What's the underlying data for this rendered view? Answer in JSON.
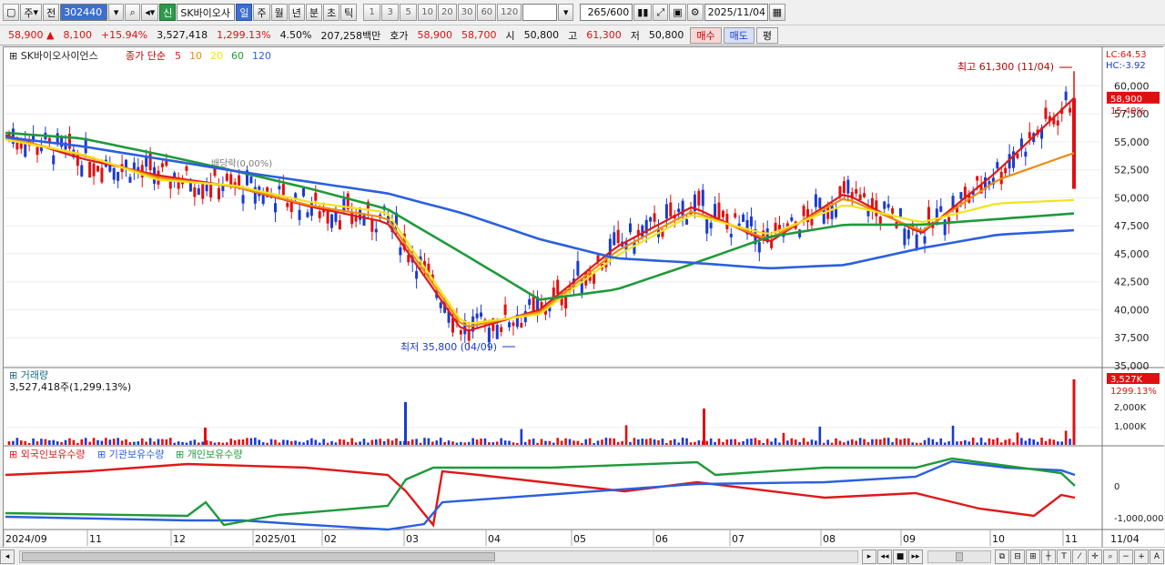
{
  "toolbar": {
    "mode": "주",
    "prev": "전",
    "code": "302440",
    "flag": "신",
    "name": "SK바이오사",
    "periods": [
      "일",
      "주",
      "월",
      "년",
      "분",
      "초",
      "틱"
    ],
    "active_period": "일",
    "intervals": [
      "1",
      "3",
      "5",
      "10",
      "20",
      "30",
      "60",
      "120"
    ],
    "count": "265",
    "count_total": "/600",
    "date": "2025/11/04"
  },
  "quote": {
    "price": "58,900",
    "arrow": "▲",
    "change": "8,100",
    "change_pct": "+15.94%",
    "volume": "3,527,418",
    "volume_ratio": "1,299.13%",
    "turnover_rate": "4.50%",
    "amount": "207,258백만",
    "bid_label": "호가",
    "ask_price": "58,900",
    "bid_price": "58,700",
    "open_label": "시",
    "open": "50,800",
    "high_label": "고",
    "high": "61,300",
    "low_label": "저",
    "low": "50,800",
    "buy": "매수",
    "sell": "매도",
    "eval": "평"
  },
  "price_panel": {
    "stock": "SK바이오사이언스",
    "ma_title": "종가 단순",
    "ma_periods": [
      "5",
      "10",
      "20",
      "60",
      "120"
    ],
    "lc": "LC:64.53",
    "hc": "HC:-3.92",
    "current_tag": "58,900",
    "current_pct": "15.49%",
    "high_annot": "최고 61,300 (11/04)",
    "low_annot": "최저 35,800 (04/09)",
    "y_ticks": [
      "60,000",
      "57,500",
      "55,000",
      "52,500",
      "50,000",
      "47,500",
      "45,000",
      "42,500",
      "40,000",
      "37,500",
      "35,000"
    ],
    "hidden_label": "배당락(0.00%)"
  },
  "volume_panel": {
    "title": "거래량",
    "value": "3,527,418주(1,299.13%)",
    "tag": "3,527K",
    "tag_pct": "1299.13%",
    "y_ticks": [
      "2,000K",
      "1,000K"
    ]
  },
  "holdings_panel": {
    "legend": [
      "외국인보유수량",
      "기관보유수량",
      "개인보유수량"
    ],
    "y_ticks": [
      "0",
      "-1,000,000"
    ]
  },
  "x_axis": {
    "labels": [
      "2024/09",
      "11",
      "12",
      "2025/01",
      "02",
      "03",
      "04",
      "05",
      "06",
      "07",
      "08",
      "09",
      "10",
      "11",
      "11/04"
    ]
  },
  "colors": {
    "ma5": "#e01818",
    "ma10": "#f08a10",
    "ma20": "#f2e220",
    "ma60": "#1e9a3a",
    "ma120": "#2a5fe0",
    "up": "#e01010",
    "down": "#1a3ad0"
  },
  "chart_data": {
    "type": "line",
    "title": "SK바이오사이언스",
    "x": [
      "2024/09",
      "11",
      "12",
      "2025/01",
      "02",
      "03",
      "04",
      "05",
      "06",
      "07",
      "08",
      "09",
      "10",
      "11",
      "11/04"
    ],
    "series": [
      {
        "name": "5",
        "values": [
          55600,
          53500,
          52000,
          51000,
          49200,
          47800,
          38000,
          40000,
          45600,
          49200,
          46000,
          50400,
          46800,
          52400,
          58900
        ]
      },
      {
        "name": "10",
        "values": [
          55400,
          53800,
          51800,
          51000,
          49300,
          48200,
          38400,
          39800,
          45200,
          48800,
          46300,
          50000,
          47000,
          51600,
          54000
        ]
      },
      {
        "name": "20",
        "values": [
          55200,
          53900,
          51600,
          51100,
          49600,
          48700,
          38700,
          39600,
          44800,
          48500,
          46700,
          49400,
          47800,
          49500,
          49800
        ]
      },
      {
        "name": "60",
        "values": [
          55800,
          55300,
          53900,
          52400,
          50800,
          49000,
          45000,
          40900,
          41800,
          44100,
          46500,
          47600,
          47600,
          48100,
          48600
        ]
      },
      {
        "name": "120",
        "values": [
          55400,
          54600,
          53500,
          52400,
          51400,
          50400,
          48600,
          46300,
          44600,
          44200,
          43700,
          44000,
          45500,
          46700,
          47100
        ]
      }
    ],
    "ylim": [
      35000,
      61000
    ],
    "extremes": {
      "high": 61300,
      "high_date": "11/04",
      "low": 35800,
      "low_date": "04/09"
    }
  }
}
